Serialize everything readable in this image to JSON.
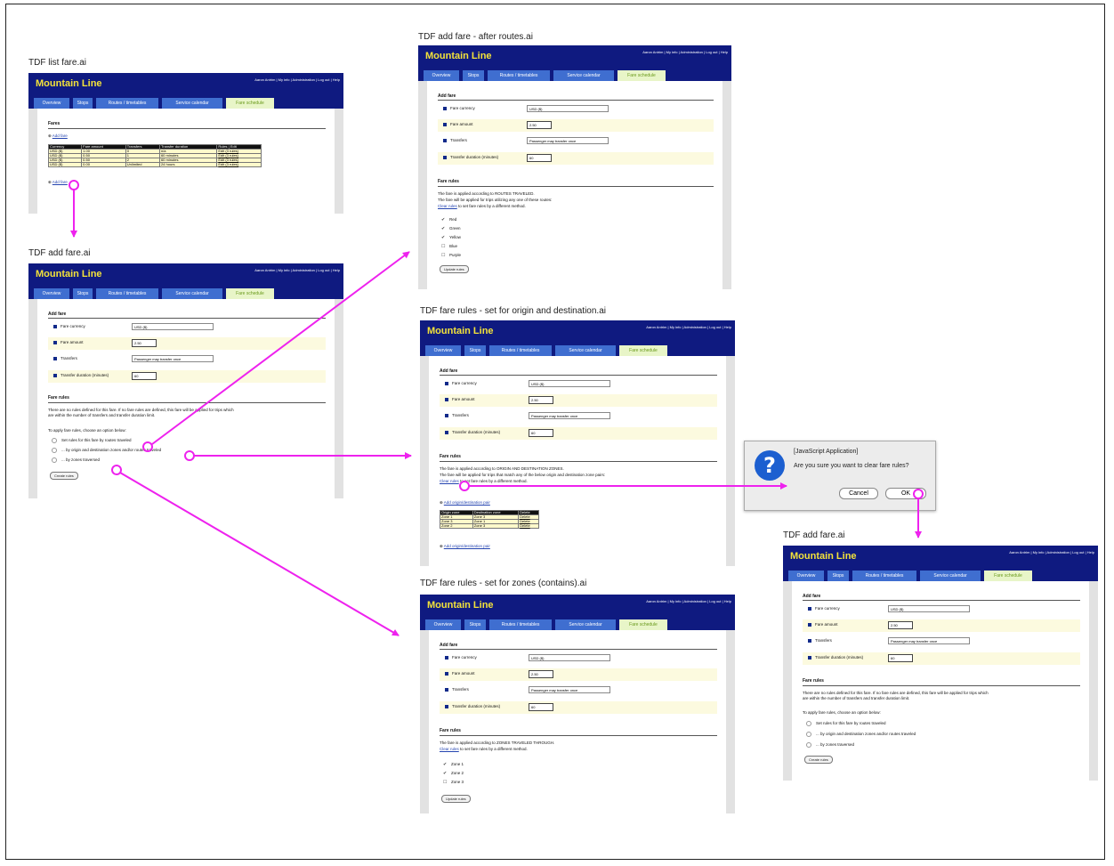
{
  "colors": {
    "arrow": "#ee22ee",
    "header": "#0f1a80",
    "logo": "#f3e23a",
    "tab": "#3f6ed0",
    "tab_active": "#e8f5c8",
    "highlight": "#fcfadf"
  },
  "app": {
    "logo": "Mountain Line",
    "user_links": "Aaron Antrim | My info | Administration | Log out | Help",
    "tabs": [
      "Overview",
      "Stops",
      "Routes / timetables",
      "Service calendar",
      "Fare schedule"
    ]
  },
  "frames": {
    "list": {
      "title": "TDF list fare.ai",
      "heading": "Fares",
      "add_fare": "Add fare",
      "table_headers": [
        "Currency",
        "Fare amount",
        "Transfers",
        "Transfer duration",
        "Rules | Edit"
      ],
      "table_rows": [
        [
          "USD ($)",
          "1.00",
          "0",
          "n/a",
          "Edit (3 rules)"
        ],
        [
          "USD ($)",
          "0.50",
          "1",
          "60 minutes",
          "Edit (3 rules)"
        ],
        [
          "USD ($)",
          "0.50",
          "2",
          "60 minutes",
          "Edit (3 rules)"
        ],
        [
          "USD ($)",
          "0.00",
          "Unlimited",
          "24 hours",
          "Edit (3 rules)"
        ]
      ]
    },
    "add": {
      "title": "TDF add fare.ai",
      "add_fare_heading": "Add fare",
      "fields": {
        "currency": "Fare currency",
        "amount": "Fare amount",
        "transfers": "Transfers",
        "duration": "Transfer duration (minutes)"
      },
      "values": {
        "currency": "USD ($)",
        "amount": "2.50",
        "transfers": "Passenger may transfer once",
        "duration": "60"
      },
      "fare_rules_heading": "Fare rules",
      "no_rules_1": "There are no rules defined for this fare.  If no fare rules are defined, this fare will be applied for trips which",
      "no_rules_2": "are within the number of transfers and transfer duration limit.",
      "choose": "To apply fare rules, choose an option below:",
      "options": [
        "Set rules for this fare by routes traveled",
        "... by origin and destination zones and/or routes traveled",
        "... by zones traversed"
      ],
      "create_button": "Create rules"
    },
    "routes": {
      "title": "TDF add fare - after routes.ai",
      "applied_1": "The fare is applied according to ROUTES TRAVELED.",
      "applied_2": "The fare will be applied for trips utilizing any one of these routes:",
      "clear_link": "Clear rules",
      "clear_rest": " to set fare rules by a different method.",
      "routes": [
        {
          "name": "Red",
          "checked": true
        },
        {
          "name": "Green",
          "checked": true
        },
        {
          "name": "Yellow",
          "checked": true
        },
        {
          "name": "Blue",
          "checked": false
        },
        {
          "name": "Purple",
          "checked": false
        }
      ],
      "update_button": "Update rules"
    },
    "od": {
      "title": "TDF fare rules - set for origin and destination.ai",
      "applied_1": "The fare is applied according to ORIGIN AND DESTINATION ZONES.",
      "applied_2": "The fare will be applied for trips that match any of the below origin and destination zone pairs:",
      "add_pair": "Add origin/destination pair",
      "pair_headers": [
        "Origin zone",
        "Destination zone",
        "Delete"
      ],
      "pairs": [
        [
          "Zone 1",
          "Zone 3",
          "Delete"
        ],
        [
          "Zone 3",
          "Zone 1",
          "Delete"
        ],
        [
          "Zone 2",
          "Zone 3",
          "Delete"
        ]
      ]
    },
    "zones": {
      "title": "TDF fare rules - set for zones (contains).ai",
      "applied_1": "The fare is applied according to ZONES TRAVELED THROUGH.",
      "zones": [
        {
          "name": "Zone 1",
          "checked": true
        },
        {
          "name": "Zone 2",
          "checked": true
        },
        {
          "name": "Zone 3",
          "checked": false
        }
      ]
    },
    "add2": {
      "title": "TDF add fare.ai"
    }
  },
  "dialog": {
    "title": "[JavaScript Application]",
    "message": "Are you sure you want to clear fare rules?",
    "cancel": "Cancel",
    "ok": "OK"
  }
}
